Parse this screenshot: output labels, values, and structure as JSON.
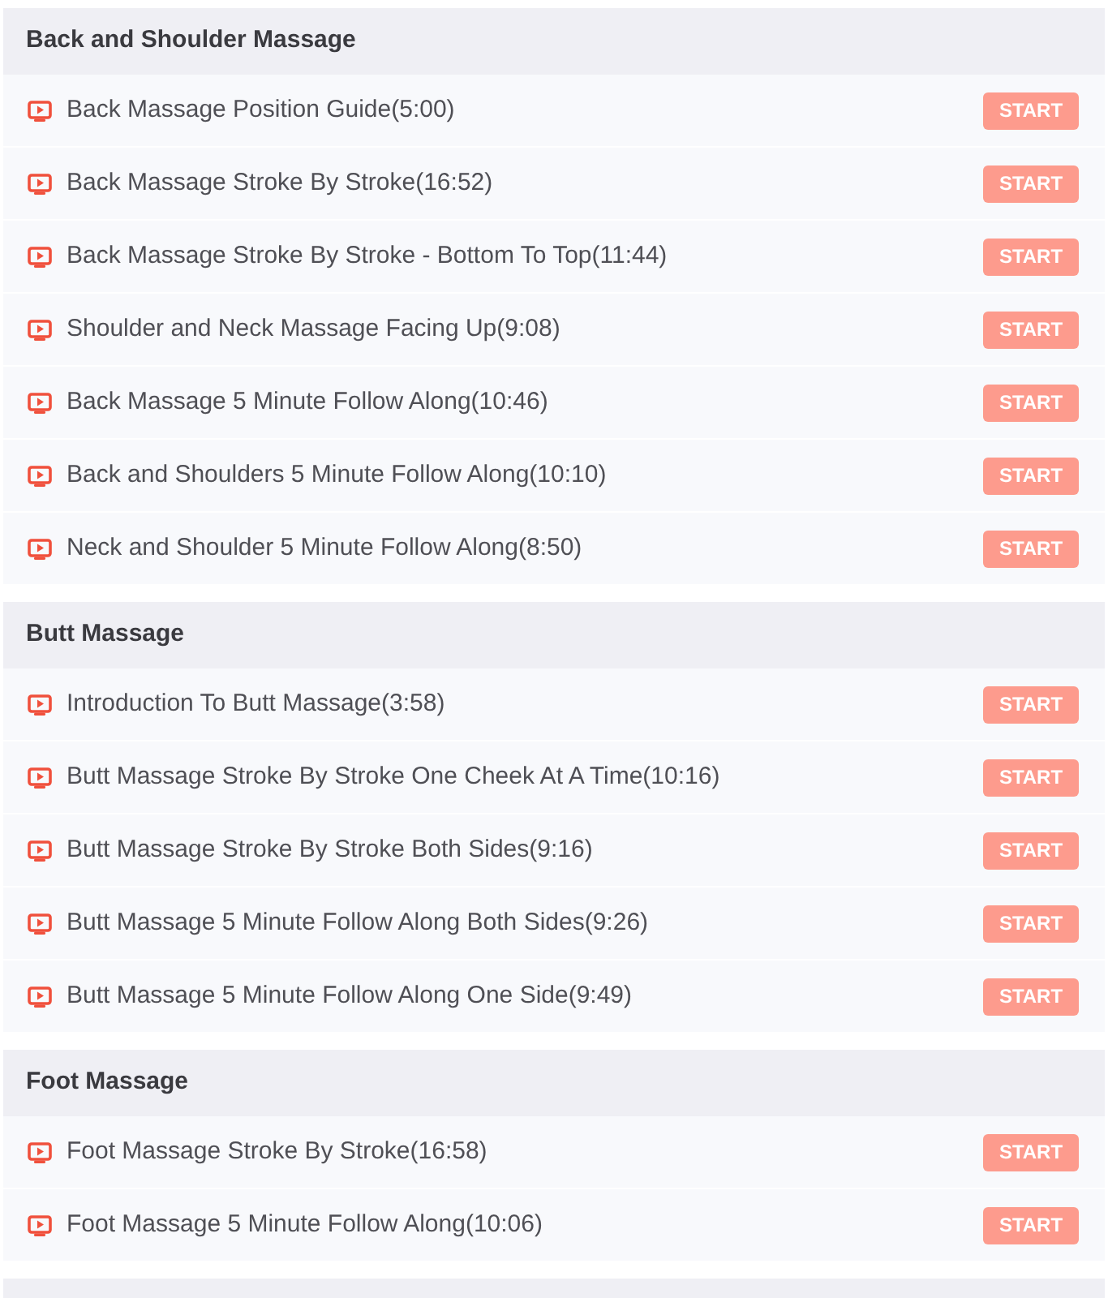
{
  "sections": [
    {
      "title": "Back and Shoulder Massage",
      "lessons": [
        {
          "title": "Back Massage Position Guide(5:00)",
          "button": "START"
        },
        {
          "title": "Back Massage Stroke By Stroke(16:52)",
          "button": "START"
        },
        {
          "title": "Back Massage Stroke By Stroke - Bottom To Top(11:44)",
          "button": "START"
        },
        {
          "title": "Shoulder and Neck Massage Facing Up(9:08)",
          "button": "START"
        },
        {
          "title": "Back Massage 5 Minute Follow Along(10:46)",
          "button": "START"
        },
        {
          "title": "Back and Shoulders 5 Minute Follow Along(10:10)",
          "button": "START"
        },
        {
          "title": "Neck and Shoulder 5 Minute Follow Along(8:50)",
          "button": "START"
        }
      ]
    },
    {
      "title": "Butt Massage",
      "lessons": [
        {
          "title": "Introduction To Butt Massage(3:58)",
          "button": "START"
        },
        {
          "title": "Butt Massage Stroke By Stroke One Cheek At A Time(10:16)",
          "button": "START"
        },
        {
          "title": "Butt Massage Stroke By Stroke Both Sides(9:16)",
          "button": "START"
        },
        {
          "title": "Butt Massage 5 Minute Follow Along Both Sides(9:26)",
          "button": "START"
        },
        {
          "title": "Butt Massage 5 Minute Follow Along One Side(9:49)",
          "button": "START"
        }
      ]
    },
    {
      "title": "Foot Massage",
      "lessons": [
        {
          "title": "Foot Massage Stroke By Stroke(16:58)",
          "button": "START"
        },
        {
          "title": "Foot Massage 5 Minute Follow Along(10:06)",
          "button": "START"
        }
      ]
    }
  ]
}
